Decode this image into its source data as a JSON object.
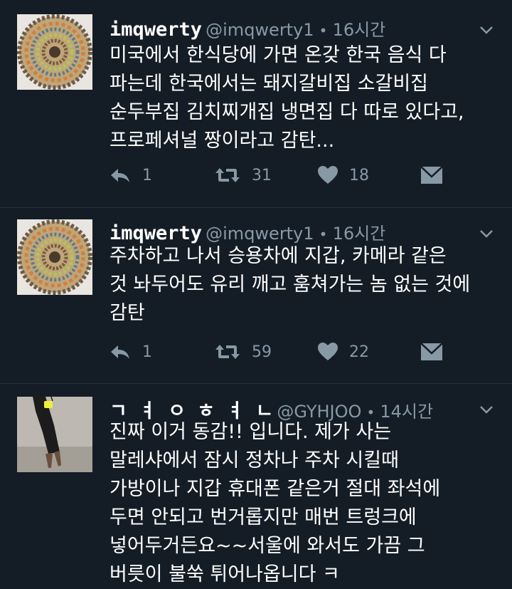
{
  "tweets": [
    {
      "name": "imqwerty",
      "handle": "@imqwerty1",
      "time": "16시간",
      "text": "미국에서 한식당에 가면 온갖 한국 음식 다\n파는데 한국에서는 돼지갈비집 소갈비집\n순두부집 김치찌개집 냉면집 다 따로 있다고,\n프로페셔널 짱이라고 감탄...",
      "reply_count": "1",
      "retweet_count": "31",
      "like_count": "18"
    },
    {
      "name": "imqwerty",
      "handle": "@imqwerty1",
      "time": "16시간",
      "text": "주차하고 나서 승용차에 지갑, 카메라 같은\n것 놔두어도 유리 깨고 훔쳐가는 놈 없는 것에\n감탄",
      "reply_count": "1",
      "retweet_count": "59",
      "like_count": "22"
    },
    {
      "name": "ㄱ ㅕ ㅇ ㅎ ㅕ ㄴ",
      "handle": "@GYHJOO",
      "time": "14시간",
      "text": "진짜 이거 동감!! 입니다. 제가 사는\n말레샤에서 잠시 정차나 주차 시킬때\n가방이나 지갑 휴대폰 같은거 절대 좌석에\n두면 안되고 번거롭지만 매번 트렁크에\n넣어두거든요~~서울에 와서도 가끔 그\n버릇이 불쑥 튀어나옵니다 ㅋ"
    }
  ],
  "separator": "•",
  "colors": {
    "background": "#141d26",
    "secondary_text": "#8899a6",
    "divider": "#243447"
  },
  "icons": {
    "reply": "reply-icon",
    "retweet": "retweet-icon",
    "like": "heart-icon",
    "dm": "envelope-icon",
    "more": "chevron-down-icon"
  }
}
